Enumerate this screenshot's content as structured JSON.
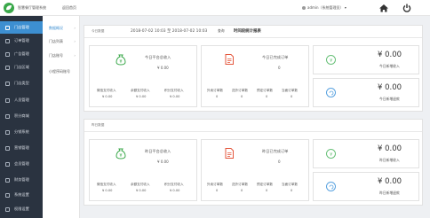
{
  "header": {
    "brand": "智慧餐厅管理系统",
    "home_link": "返回首页",
    "user": "admin（系统管理员）"
  },
  "sidebar": {
    "items": [
      {
        "label": "门店管理",
        "active": true
      },
      {
        "label": "订单管理"
      },
      {
        "label": "广告管理"
      },
      {
        "label": "门店区域"
      },
      {
        "label": "门店类型"
      },
      {
        "label": "人员管理"
      },
      {
        "label": "积分商城"
      },
      {
        "label": "分销系统"
      },
      {
        "label": "营销管理"
      },
      {
        "label": "会员管理"
      },
      {
        "label": "财务管理"
      },
      {
        "label": "系统设置"
      },
      {
        "label": "权限设置"
      }
    ]
  },
  "subnav": {
    "items": [
      {
        "label": "数据概况",
        "active": true
      },
      {
        "label": "门店列表"
      },
      {
        "label": "门店账号"
      },
      {
        "label": "小程序码账号"
      }
    ]
  },
  "today": {
    "title": "今日数据",
    "date_range": "2018-07-02 10:03 至 2018-07-02 10:03",
    "query_label": "查询",
    "range_label": "时间段统计报表",
    "income_label": "今日平台总收入",
    "income_value": "¥ 0.00",
    "subs": [
      {
        "label": "微信支付收入",
        "value": "¥ 0.00"
      },
      {
        "label": "余额支付收入",
        "value": "¥ 0.00"
      },
      {
        "label": "积分支付收入",
        "value": "¥ 0.00"
      }
    ],
    "orders_label": "今日已完成订单",
    "orders_value": "0",
    "order_subs": [
      {
        "label": "外卖订单数",
        "value": "0"
      },
      {
        "label": "送外订单数",
        "value": "0"
      },
      {
        "label": "预定订单数",
        "value": "0"
      },
      {
        "label": "当面订单数",
        "value": "0"
      }
    ],
    "new_money": "¥ 0.00",
    "new_label": "今日新增收入",
    "refund_money": "¥ 0.00",
    "refund_label": "今日新增退款"
  },
  "yesterday": {
    "title": "昨日数据",
    "income_label": "昨日平台总收入",
    "income_value": "¥ 0.00",
    "subs": [
      {
        "label": "微信支付收入",
        "value": "¥ 0.00"
      },
      {
        "label": "余额支付收入",
        "value": "¥ 0.00"
      },
      {
        "label": "积分支付收入",
        "value": "¥ 0.00"
      }
    ],
    "orders_label": "昨日已完成订单",
    "orders_value": "0",
    "order_subs": [
      {
        "label": "外卖订单数",
        "value": "0"
      },
      {
        "label": "送外订单数",
        "value": "0"
      },
      {
        "label": "预定订单数",
        "value": "0"
      },
      {
        "label": "当面订单数",
        "value": "0"
      }
    ],
    "new_money": "¥ 0.00",
    "new_label": "昨日新增收入",
    "refund_money": "¥ 0.00",
    "refund_label": "昨日新增退款"
  },
  "icons": {
    "logo": "leaf-logo-icon",
    "home": "home-icon",
    "power": "power-icon",
    "money_bag": "money-bag-icon",
    "document": "document-icon",
    "yen_circle": "yen-circle-icon",
    "refund_circle": "refund-circle-icon"
  },
  "colors": {
    "sidebar_bg": "#2a3340",
    "accent": "#3d8fd1",
    "green": "#3aa84a",
    "doc_red": "#e4573d",
    "yen_green": "#6ac17a",
    "refund_blue": "#5aa3e0"
  }
}
